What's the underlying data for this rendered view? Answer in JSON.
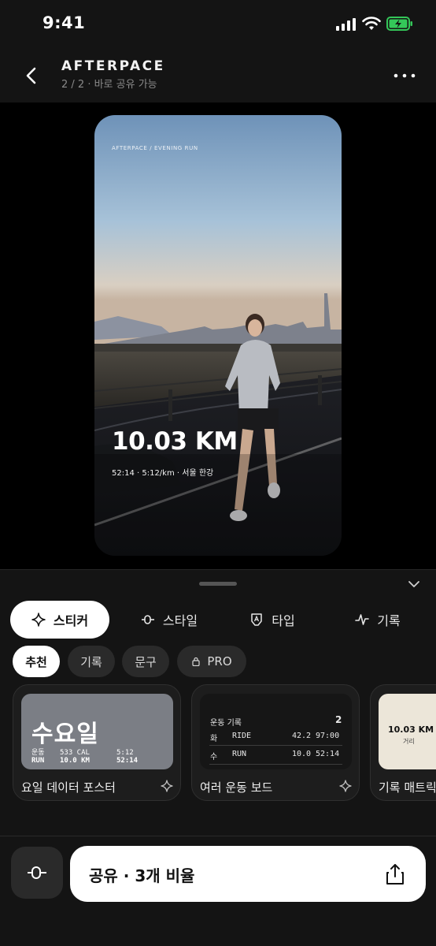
{
  "status_bar": {
    "time": "9:41"
  },
  "header": {
    "title": "AFTERPACE",
    "subtitle": "2 / 2 · 바로 공유 가능"
  },
  "preview": {
    "brand_line": "AFTERPACE / EVENING RUN",
    "distance": "10.03 KM",
    "stats": "52:14  ·  5:12/km  ·  서울 한강"
  },
  "tabs": [
    {
      "label": "스티커",
      "icon": "sparkle-icon"
    },
    {
      "label": "스타일",
      "icon": "slider-icon"
    },
    {
      "label": "타입",
      "icon": "type-icon"
    },
    {
      "label": "기록",
      "icon": "activity-icon"
    }
  ],
  "chips": [
    {
      "label": "추천"
    },
    {
      "label": "기록"
    },
    {
      "label": "문구"
    },
    {
      "label": "PRO",
      "icon": "lock-icon"
    }
  ],
  "templates": {
    "poster": {
      "label": "요일 데이터 포스터",
      "day": "수요일",
      "row1": [
        "운동",
        "533 CAL",
        "5:12"
      ],
      "row2": [
        "RUN",
        "10.0 KM",
        "52:14"
      ]
    },
    "board": {
      "label": "여러 운동 보드",
      "heading": "운동 기록",
      "count": "2",
      "rows": [
        [
          "화",
          "RIDE",
          "42.2",
          "97:00"
        ],
        [
          "수",
          "RUN",
          "10.0",
          "52:14"
        ]
      ]
    },
    "matrix": {
      "label": "기록 매트릭",
      "value": "10.03 KM",
      "key": "거리"
    }
  },
  "share": {
    "label": "공유 · 3개 비율"
  },
  "colors": {
    "sheet": "#141414",
    "accent": "#ffffff",
    "battery": "#34c759"
  }
}
